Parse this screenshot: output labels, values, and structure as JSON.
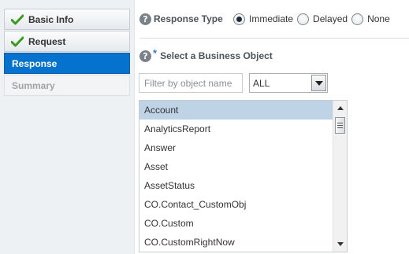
{
  "nav": {
    "items": [
      {
        "label": "Basic Info",
        "state": "completed"
      },
      {
        "label": "Request",
        "state": "completed"
      },
      {
        "label": "Response",
        "state": "active"
      },
      {
        "label": "Summary",
        "state": "disabled"
      }
    ]
  },
  "response_type": {
    "help_glyph": "?",
    "label": "Response Type",
    "options": [
      {
        "label": "Immediate",
        "selected": true
      },
      {
        "label": "Delayed",
        "selected": false
      },
      {
        "label": "None",
        "selected": false
      }
    ]
  },
  "business_object": {
    "help_glyph": "?",
    "required_marker": "*",
    "label": "Select a Business Object",
    "filter_placeholder": "Filter by object name",
    "filter_value": "",
    "select_value": "ALL",
    "items": [
      "Account",
      "AnalyticsReport",
      "Answer",
      "Asset",
      "AssetStatus",
      "CO.Contact_CustomObj",
      "CO.Custom",
      "CO.CustomRightNow"
    ],
    "selected_item": "Account"
  },
  "colors": {
    "active_nav": "#0572ce",
    "selected_row": "#bfd3e6",
    "check_green": "#3c9a1e",
    "required_star": "#3b79c4"
  },
  "icons": {
    "completed": "checkmark-icon",
    "help": "help-icon",
    "dropdown": "chevron-down-icon"
  }
}
